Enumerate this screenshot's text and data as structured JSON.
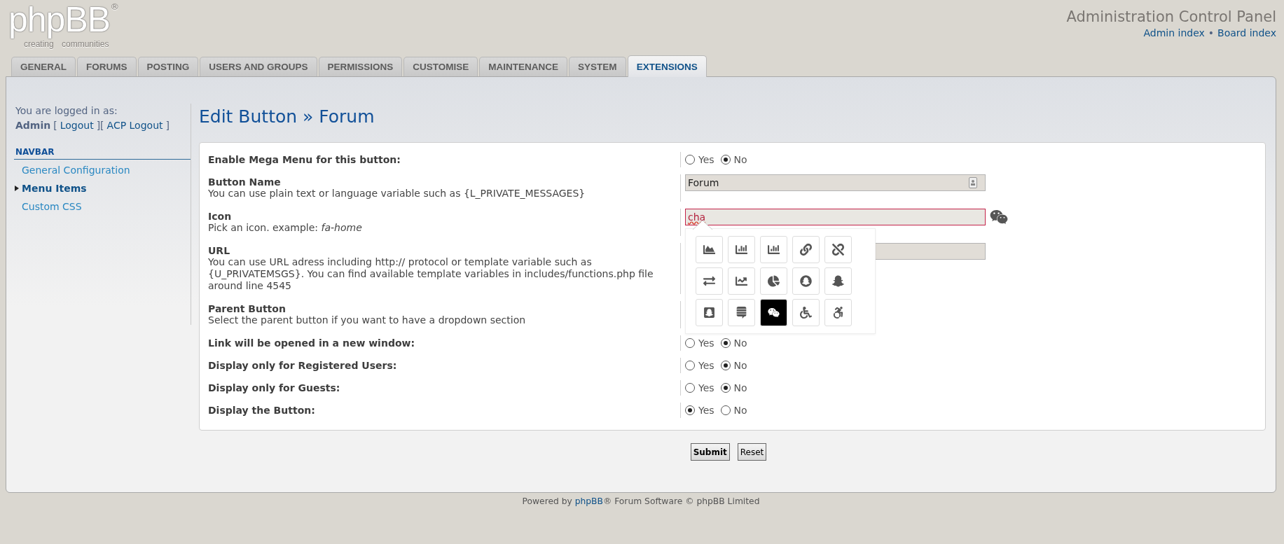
{
  "logo": {
    "wordmark": "phpBB",
    "mark": "®",
    "tagline": "creating communities"
  },
  "header": {
    "title": "Administration Control Panel",
    "links": [
      "Admin index",
      "Board index"
    ],
    "separator": "•"
  },
  "tabs": [
    {
      "label": "GENERAL",
      "selected": false
    },
    {
      "label": "FORUMS",
      "selected": false
    },
    {
      "label": "POSTING",
      "selected": false
    },
    {
      "label": "USERS AND GROUPS",
      "selected": false
    },
    {
      "label": "PERMISSIONS",
      "selected": false
    },
    {
      "label": "CUSTOMISE",
      "selected": false
    },
    {
      "label": "MAINTENANCE",
      "selected": false
    },
    {
      "label": "SYSTEM",
      "selected": false
    },
    {
      "label": "EXTENSIONS",
      "selected": true
    }
  ],
  "sidebar": {
    "logged_in_label": "You are logged in as:",
    "user": "Admin",
    "brackets": [
      "[",
      "][",
      "]"
    ],
    "logout": "Logout",
    "acp_logout": "ACP Logout",
    "section": "NAVBAR",
    "items": [
      {
        "label": "General Configuration",
        "selected": false
      },
      {
        "label": "Menu Items",
        "selected": true
      },
      {
        "label": "Custom CSS",
        "selected": false
      }
    ]
  },
  "page_title": "Edit Button » Forum",
  "form": {
    "rows": [
      {
        "kind": "radio",
        "label": "Enable Mega Menu for this button:",
        "options": [
          {
            "label": "Yes",
            "selected": false
          },
          {
            "label": "No",
            "selected": true
          }
        ]
      },
      {
        "kind": "text",
        "label": "Button Name",
        "description": "You can use plain text or language variable such as {L_PRIVATE_MESSAGES}",
        "value": "Forum",
        "autofill": true
      },
      {
        "kind": "icon",
        "label": "Icon",
        "description": "Pick an icon. example: *fa-home*",
        "value": "cha",
        "invalid": true,
        "picker": {
          "open": true,
          "icons": [
            {
              "selected": false
            },
            {
              "selected": false
            },
            {
              "selected": false
            },
            {
              "selected": false
            },
            {
              "selected": false
            },
            {
              "selected": false
            },
            {
              "selected": false
            },
            {
              "selected": false
            },
            {
              "selected": false
            },
            {
              "selected": false
            },
            {
              "selected": false
            },
            {
              "selected": false
            },
            {
              "selected": true
            },
            {
              "selected": false
            },
            {
              "selected": false
            }
          ]
        }
      },
      {
        "kind": "text",
        "label": "URL",
        "description": "You can use URL adress including http:// protocol or template variable such as {U_PRIVATEMSGS}. You can find available template variables in includes/functions.php file around line 4545"
      },
      {
        "kind": "plain",
        "label": "Parent Button",
        "description": "Select the parent button if you want to have a dropdown section"
      },
      {
        "kind": "radio",
        "label": "Link will be opened in a new window:",
        "options": [
          {
            "label": "Yes",
            "selected": false
          },
          {
            "label": "No",
            "selected": true
          }
        ]
      },
      {
        "kind": "radio",
        "label": "Display only for Registered Users:",
        "options": [
          {
            "label": "Yes",
            "selected": false
          },
          {
            "label": "No",
            "selected": true
          }
        ]
      },
      {
        "kind": "radio",
        "label": "Display only for Guests:",
        "options": [
          {
            "label": "Yes",
            "selected": false
          },
          {
            "label": "No",
            "selected": true
          }
        ]
      },
      {
        "kind": "radio",
        "label": "Display the Button:",
        "options": [
          {
            "label": "Yes",
            "selected": true
          },
          {
            "label": "No",
            "selected": false
          }
        ]
      }
    ]
  },
  "buttons": [
    {
      "label": "Submit",
      "primary": true
    },
    {
      "label": "Reset",
      "primary": false
    }
  ],
  "footer": {
    "prefix": "Powered by ",
    "link": "phpBB",
    "suffix": "® Forum Software © phpBB Limited"
  }
}
